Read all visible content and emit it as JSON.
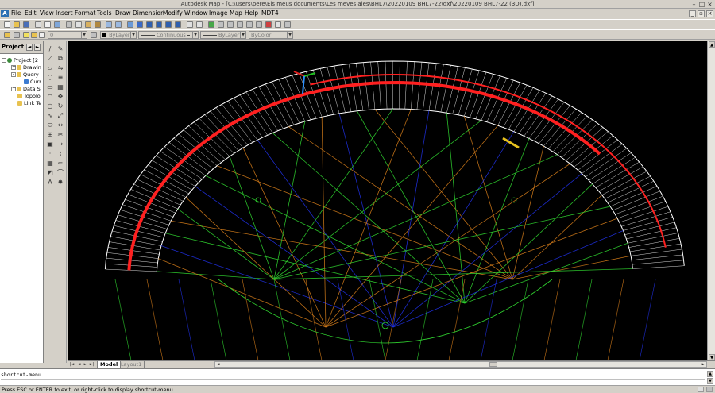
{
  "window": {
    "title": "Autodesk Map - [C:\\users\\pere\\Els meus documents\\Les meves ales\\BHL7\\20220109 BHL7-22\\dxf\\20220109 BHL7-22 (3D).dxf]"
  },
  "menubar": {
    "items": [
      "File",
      "Edit",
      "View",
      "Insert",
      "Format",
      "Tools",
      "Draw",
      "Dimension",
      "Modify",
      "Window",
      "Image",
      "Map",
      "Help",
      "MDT4"
    ]
  },
  "toolbar2": {
    "layer_value": "0",
    "color_value": "ByLayer",
    "linetype_value": "Continuous",
    "lineweight_value": "ByLayer",
    "plotstyle_value": "ByColor"
  },
  "project": {
    "tab_label": "Project",
    "tree": {
      "root": "Project [2",
      "items": [
        "Drawin",
        "Query",
        "Curr",
        "Data S",
        "Topolo",
        "Link Te"
      ]
    }
  },
  "layout_tabs": {
    "model": "Model",
    "layout": "Layout1"
  },
  "command": {
    "history": "shortcut-menu",
    "prompt": ""
  },
  "status": {
    "message": "Press ESC or ENTER to exit, or right-click to display shortcut-menu."
  },
  "colors": {
    "background": "#000000",
    "ui": "#d4d0c8",
    "wireframe_white": "#ffffff",
    "leading_edge": "#ff2020",
    "lines_green": "#2fd02f",
    "lines_orange": "#d07a1a",
    "lines_blue": "#2030e0",
    "lines_yellow": "#e6c01e"
  },
  "icons": {
    "app": "autocad-map-icon",
    "ucs": "ucs-axes-icon",
    "draw_tools": [
      "line-icon",
      "construction-line-icon",
      "polyline-icon",
      "polygon-icon",
      "rectangle-icon",
      "arc-icon",
      "circle-icon",
      "spline-icon",
      "ellipse-icon",
      "insert-block-icon",
      "make-block-icon",
      "point-icon",
      "hatch-icon",
      "region-icon",
      "text-icon"
    ],
    "modify_tools": [
      "erase-icon",
      "copy-icon",
      "mirror-icon",
      "offset-icon",
      "array-icon",
      "move-icon",
      "rotate-icon",
      "scale-icon",
      "stretch-icon",
      "trim-icon",
      "extend-icon",
      "break-icon",
      "chamfer-icon",
      "fillet-icon",
      "explode-icon"
    ]
  }
}
